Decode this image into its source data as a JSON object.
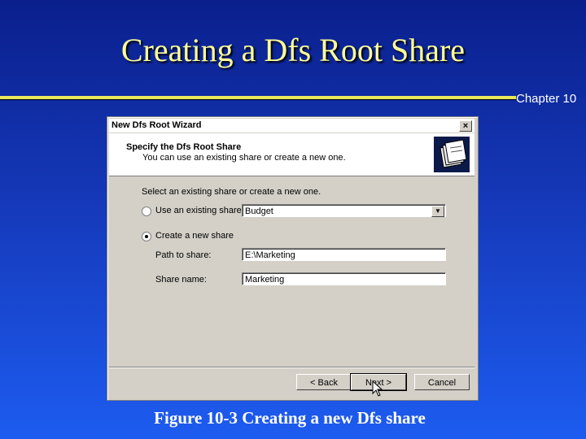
{
  "slide": {
    "title": "Creating a Dfs Root Share",
    "chapter": "Chapter 10",
    "caption": "Figure 10-3  Creating a new Dfs share",
    "accent_color": "#e8e85a",
    "title_color": "#ffff99"
  },
  "dialog": {
    "window_title": "New Dfs Root Wizard",
    "close_glyph": "×",
    "header_title": "Specify the Dfs Root Share",
    "header_subtitle": "You can use an existing share or create a new one.",
    "header_icon": "folders-icon",
    "instruction": "Select an existing share or create a new one.",
    "options": {
      "existing_label": "Use an existing share",
      "existing_selected": false,
      "existing_value": "Budget",
      "new_label": "Create a new share",
      "new_selected": true
    },
    "path_label": "Path to share:",
    "path_value": "E:\\Marketing",
    "share_label": "Share name:",
    "share_value": "Marketing",
    "buttons": {
      "back": "< Back",
      "next": "Next >",
      "cancel": "Cancel"
    }
  }
}
